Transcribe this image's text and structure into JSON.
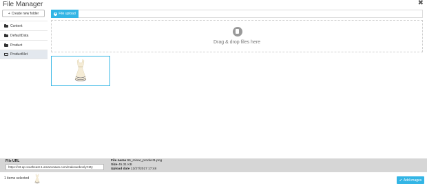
{
  "header": {
    "title": "File Manager",
    "close_glyph": "✖"
  },
  "sidebar": {
    "new_folder_label": "Create new folder",
    "new_folder_glyph": "+",
    "items": [
      {
        "label": "Content",
        "icon": "folder-icon",
        "active": false
      },
      {
        "label": "DefaultData",
        "icon": "folder-icon",
        "active": false
      },
      {
        "label": "Product",
        "icon": "folder-icon",
        "active": false
      },
      {
        "label": "ProductNet",
        "icon": "folder-open-icon",
        "active": true
      }
    ]
  },
  "upload": {
    "button_label": "File upload",
    "dropzone_text": "Drag & drop files here",
    "dropzone_icon": "file-icon"
  },
  "files": [
    {
      "name": "96_minar_product1.png",
      "thumbnail": "dress-thumbnail",
      "selected": true
    }
  ],
  "details": {
    "file_url_label": "File URL",
    "file_url_value": "https://s3-ap-southeast-1.amazonaws.com/makewebonlyCMy",
    "file_name_label": "File name",
    "file_name_value": "96_minar_product1.png",
    "size_label": "Size",
    "size_value": "45.31 KB",
    "upload_date_label": "Upload date",
    "upload_date_value": "12/27/2017 17:48"
  },
  "footer": {
    "selected_text": "1 items selected",
    "add_button_label": "Add images",
    "add_button_glyph": "✔"
  },
  "colors": {
    "accent": "#33b5e5",
    "footer_bg": "#d6d6d6",
    "sidebar_active_bg": "#e3e8ee"
  }
}
